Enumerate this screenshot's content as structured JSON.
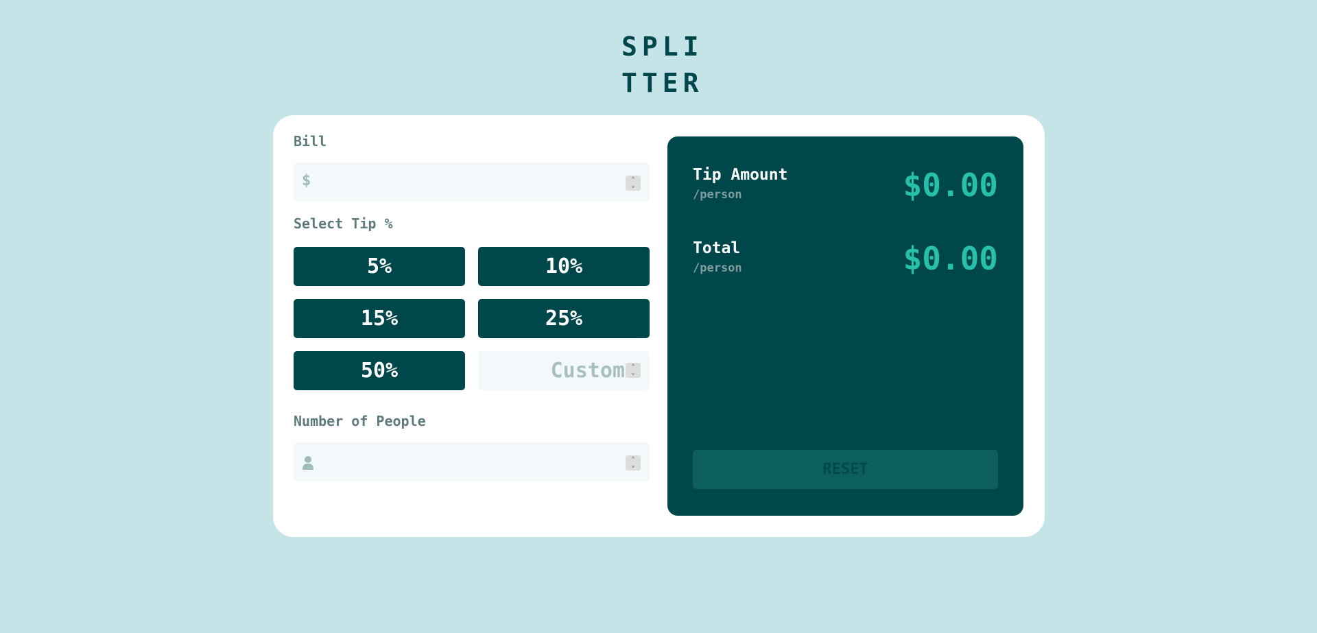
{
  "logo": {
    "line1": "SPLI",
    "line2": "TTER"
  },
  "bill": {
    "label": "Bill",
    "prefix": "$",
    "value": ""
  },
  "tip": {
    "label": "Select Tip %",
    "options": [
      "5%",
      "10%",
      "15%",
      "25%",
      "50%"
    ],
    "custom_placeholder": "Custom"
  },
  "people": {
    "label": "Number of People",
    "value": ""
  },
  "result": {
    "tip_amount": {
      "title": "Tip Amount",
      "sub": "/person",
      "value": "$0.00"
    },
    "total": {
      "title": "Total",
      "sub": "/person",
      "value": "$0.00"
    },
    "reset_label": "RESET"
  },
  "colors": {
    "background": "#c5e4e7",
    "dark_cyan": "#00474b",
    "strong_cyan": "#26c0ab",
    "input_bg": "#f3f9fa",
    "label_grey": "#5e7a7d"
  },
  "icons": {
    "bill_prefix": "dollar-icon",
    "people_prefix": "person-icon",
    "spinner": "spinner-arrows-icon"
  }
}
